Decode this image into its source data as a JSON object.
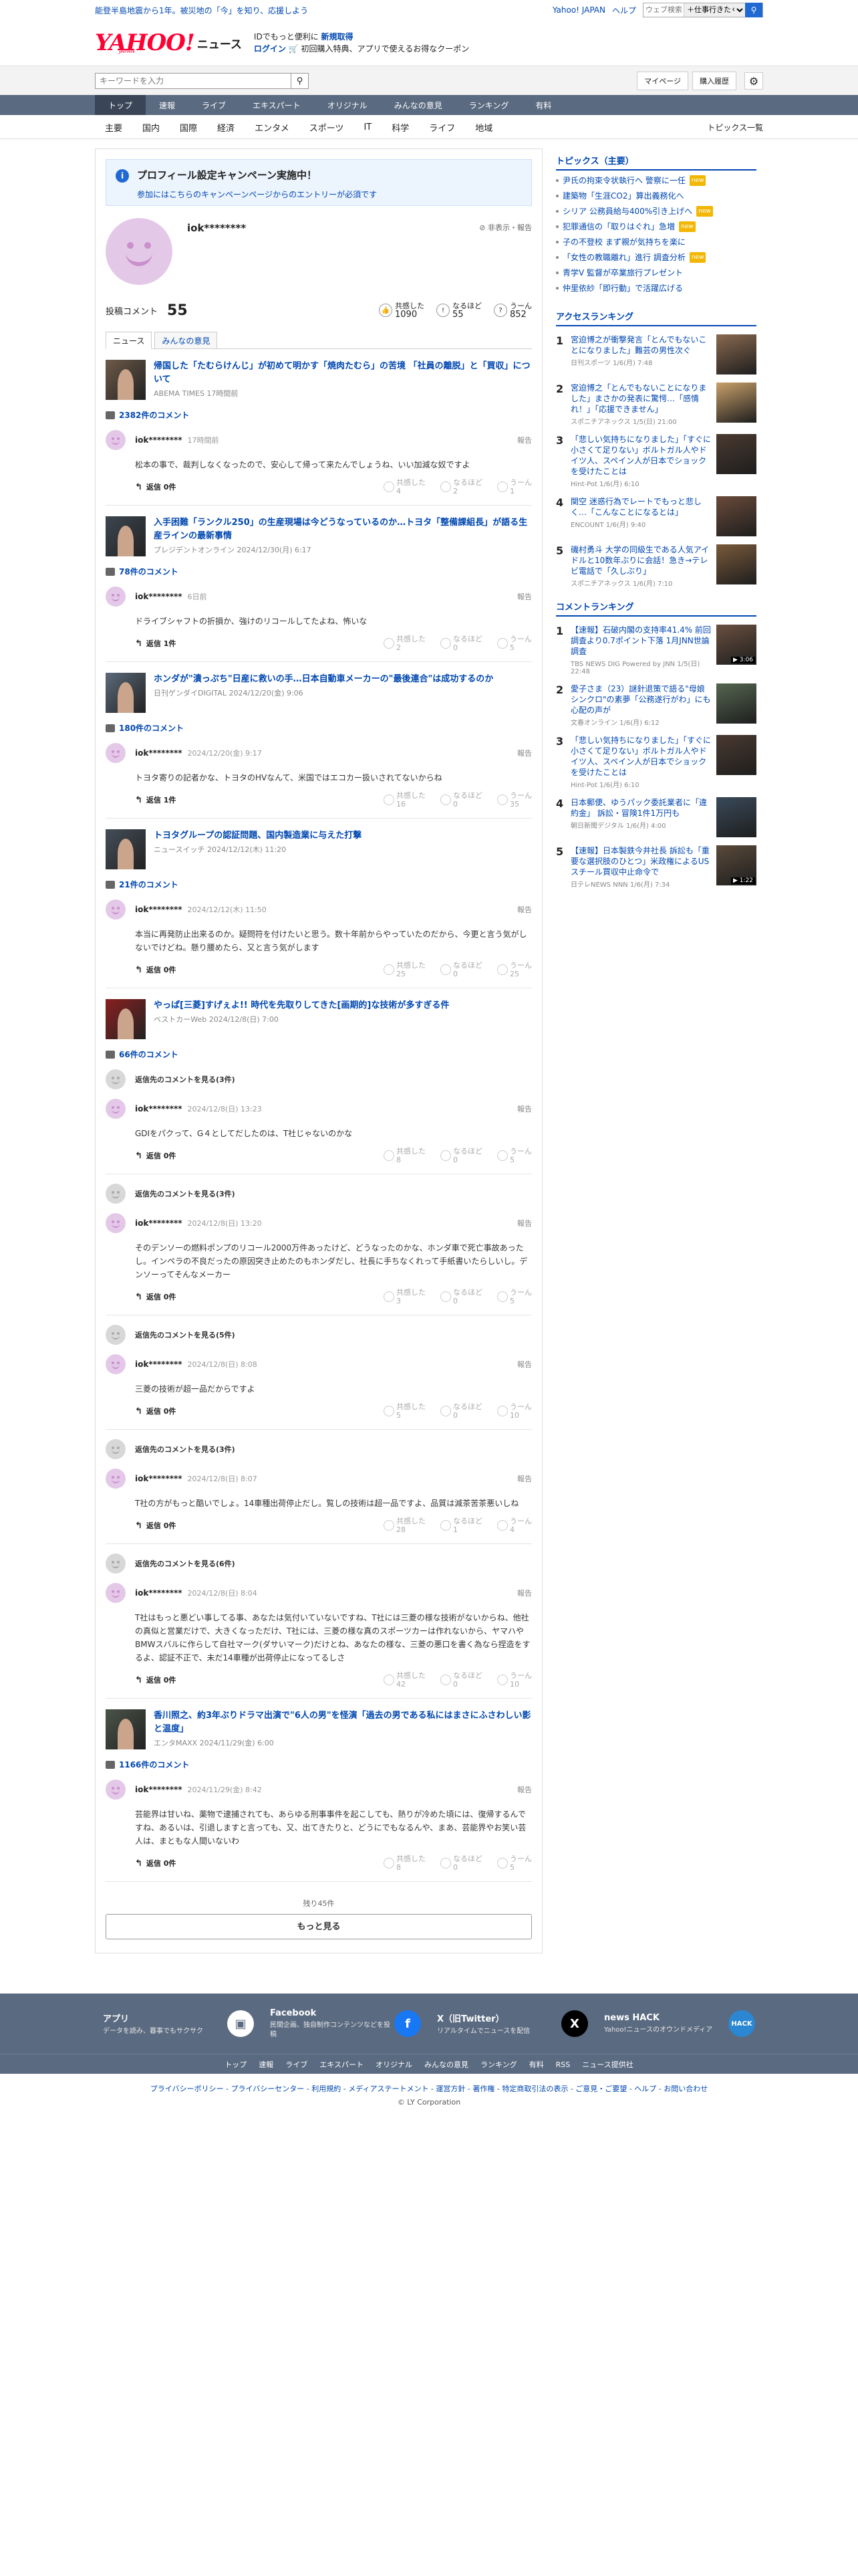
{
  "topbar": {
    "notice": "能登半島地震から1年。被災地の「今」を知り、応援しよう",
    "links": [
      "Yahoo! JAPAN",
      "ヘルプ"
    ],
    "search_placeholder": "ウェブ検索",
    "search_scope": "＋仕事行きたく..."
  },
  "header": {
    "logo": "YAHOO!",
    "logo_sub": "JAPAN",
    "logo_news": "ニュース",
    "promo_line1a": "IDでもっと便利に",
    "promo_line1b": "新規取得",
    "promo_login": "ログイン",
    "promo_line2": "初回購入特典、アプリで使えるお得なクーポン"
  },
  "search": {
    "placeholder": "キーワードを入力",
    "mypage": "マイページ",
    "history": "購入履歴"
  },
  "gnav": [
    "トップ",
    "速報",
    "ライブ",
    "エキスパート",
    "オリジナル",
    "みんなの意見",
    "ランキング",
    "有料"
  ],
  "subnav": [
    "主要",
    "国内",
    "国際",
    "経済",
    "エンタメ",
    "スポーツ",
    "IT",
    "科学",
    "ライフ",
    "地域"
  ],
  "subnav_right": "トピックス一覧",
  "campaign": {
    "title": "プロフィール設定キャンペーン実施中！",
    "sub": "参加にはこちらのキャンペーンページからのエントリーが必須です"
  },
  "profile": {
    "name": "iok********",
    "report": "非表示・報告",
    "comments_label": "投稿コメント",
    "comments_count": "55",
    "r1_label": "共感した",
    "r1": "1090",
    "r2_label": "なるほど",
    "r2": "55",
    "r3_label": "うーん",
    "r3": "852"
  },
  "tabs": [
    "ニュース",
    "みんなの意見"
  ],
  "reply_label": "返信 0件",
  "reply_label1": "返信 1件",
  "report_label": "報告",
  "react_labels": [
    "共感した",
    "なるほど",
    "うーん"
  ],
  "threads": [
    {
      "title": "帰国した「たむらけんじ」が初めて明かす「焼肉たむら」の苦境 「社員の離脱」と「買収」について",
      "source": "ABEMA TIMES 17時間前",
      "count": "2382件のコメント",
      "comments": [
        {
          "user": "iok********",
          "time": "17時間前",
          "body": "松本の事で、裁判しなくなったので、安心して帰って来たんでしょうね、いい加減な奴ですよ",
          "reply": "返信 0件",
          "r": [
            "4",
            "2",
            "1"
          ]
        }
      ]
    },
    {
      "title": "入手困難「ランクル250」の生産現場は今どうなっているのか…トヨタ「整備課組長」が語る生産ラインの最新事情",
      "source": "プレジデントオンライン 2024/12/30(月) 6:17",
      "count": "78件のコメント",
      "comments": [
        {
          "user": "iok********",
          "time": "6日前",
          "body": "ドライブシャフトの折損か、強けのリコールしてたよね、怖いな",
          "reply": "返信 1件",
          "r": [
            "2",
            "0",
            "5"
          ]
        }
      ]
    },
    {
      "title": "ホンダが\"潰っぷち\"日産に救いの手…日本自動車メーカーの\"最後連合\"は成功するのか",
      "source": "日刊ゲンダイDIGITAL 2024/12/20(金) 9:06",
      "count": "180件のコメント",
      "comments": [
        {
          "user": "iok********",
          "time": "2024/12/20(金) 9:17",
          "body": "トヨタ寄りの記者かな、トヨタのHVなんて、米国ではエコカー扱いされてないからね",
          "reply": "返信 1件",
          "r": [
            "16",
            "0",
            "35"
          ]
        }
      ]
    },
    {
      "title": "トヨタグループの認証問題、国内製造業に与えた打撃",
      "source": "ニュースイッチ 2024/12/12(木) 11:20",
      "count": "21件のコメント",
      "comments": [
        {
          "user": "iok********",
          "time": "2024/12/12(木) 11:50",
          "body": "本当に再発防止出来るのか。疑問符を付けたいと思う。数十年前からやっていたのだから、今更と言う気がしないでけどね。懸り腰めたら、又と言う気がします",
          "reply": "返信 0件",
          "r": [
            "25",
            "0",
            "25"
          ]
        }
      ]
    },
    {
      "title": "やっぱ[三菱]すげぇよ!! 時代を先取りしてきた[画期的]な技術が多すぎる件",
      "source": "ベストカーWeb 2024/12/8(日) 7:00",
      "count": "66件のコメント",
      "comments": [
        {
          "tree": "返信先のコメントを見る(3件)",
          "user": "iok********",
          "time": "2024/12/8(日) 13:23",
          "body": "GDIをパクって、G４としてだしたのは、T社じゃないのかな",
          "reply": "返信 0件",
          "r": [
            "8",
            "0",
            "5"
          ]
        },
        {
          "tree": "返信先のコメントを見る(3件)",
          "user": "iok********",
          "time": "2024/12/8(日) 13:20",
          "body": "そのデンソーの燃料ポンプのリコール2000万件あったけど、どうなったのかな、ホンダ車で死亡事故あったし。インペラの不良だったの原因突き止めたのもホンダだし、社長に手ちなくれって手紙書いたらしいし。デンソーってそんなメーカー",
          "reply": "返信 0件",
          "r": [
            "3",
            "0",
            "5"
          ]
        },
        {
          "tree": "返信先のコメントを見る(5件)",
          "user": "iok********",
          "time": "2024/12/8(日) 8:08",
          "body": "三菱の技術が超一品だからですよ",
          "reply": "返信 0件",
          "r": [
            "5",
            "0",
            "10"
          ]
        },
        {
          "tree": "返信先のコメントを見る(3件)",
          "user": "iok********",
          "time": "2024/12/8(日) 8:07",
          "body": "T社の方がもっと酷いでしょ。14車種出荷停止だし。覧しの技術は超一品ですよ、品質は減茶苦茶悪いしね",
          "reply": "返信 0件",
          "r": [
            "28",
            "1",
            "4"
          ]
        },
        {
          "tree": "返信先のコメントを見る(6件)",
          "user": "iok********",
          "time": "2024/12/8(日) 8:04",
          "body": "T社はもっと悪どい事してる事、あなたは気付いていないですね、T社には三菱の様な技術がないからね、他社の真似と営業だけで、大きくなっただけ、T社には、三菱の様な真のスポーツカーは作れないから、ヤマハやBMWスバルに作らして自社マーク(ダサいマーク)だけとね、あなたの様な、三菱の悪口を書く為なら捏造をするよ、認証不正で、未だ14車種が出荷停止になってるしさ",
          "reply": "返信 0件",
          "r": [
            "42",
            "0",
            "10"
          ]
        }
      ]
    },
    {
      "title": "香川照之、約3年ぶりドラマ出演で\"6人の男\"を怪演「過去の男である私にはまさにふさわしい影と温度」",
      "source": "エンタMAXX 2024/11/29(金) 6:00",
      "count": "1166件のコメント",
      "comments": [
        {
          "user": "iok********",
          "time": "2024/11/29(金) 8:42",
          "body": "芸能界は甘いね、薬物で逮捕されても、あらゆる刑事事件を起こしても、熱りが冷めた頃には、復帰するんですね、あるいは、引退しますと言っても、又、出てきたりと、どうにでもなるんや、まあ、芸能界やお笑い芸人は、まともな人間いないわ",
          "reply": "返信 0件",
          "r": [
            "8",
            "0",
            "5"
          ]
        }
      ]
    }
  ],
  "more": {
    "remaining": "残り45件",
    "button": "もっと見る"
  },
  "right": {
    "topics_title": "トピックス（主要）",
    "topics": [
      {
        "t": "尹氏の拘束令状執行へ 警察に一任",
        "tag": "new"
      },
      {
        "t": "建築物「生涯CO2」算出義務化へ",
        "tag": ""
      },
      {
        "t": "シリア 公務員給与400%引き上げへ",
        "tag": "new"
      },
      {
        "t": "犯罪通信の「取りはぐれ」急増",
        "tag": "new"
      },
      {
        "t": "子の不登校 まず親が気持ちを楽に",
        "tag": ""
      },
      {
        "t": "「女性の教職離れ」進行 調査分析",
        "tag": "new"
      },
      {
        "t": "青学V 監督が卒業旅行プレゼント",
        "tag": ""
      },
      {
        "t": "仲里依紗「即行動」で活躍広げる",
        "tag": ""
      }
    ],
    "access_title": "アクセスランキング",
    "access": [
      {
        "n": "1",
        "t": "宮迫博之が衝撃発言「とんでもないことになりました」難芸の男性次ぐ",
        "s": "日刊スポーツ 1/6(月) 7:48",
        "c": "#8a6a50",
        "v": ""
      },
      {
        "n": "2",
        "t": "宮迫博之「とんでもないことになりました」まさかの発表に驚愕…「感情れ！」「応援できません」",
        "s": "スポニチアネックス 1/5(日) 21:00",
        "c": "#c9a06a",
        "v": ""
      },
      {
        "n": "3",
        "t": "「悲しい気持ちになりました」「すぐに小さくて足りない」ボルトガル人やドイツ人、スペイン人が日本でショックを受けたことは",
        "s": "Hint-Pot 1/6(月) 6:10",
        "c": "#4a3a30",
        "v": ""
      },
      {
        "n": "4",
        "t": "関空 迷惑行為でレートでもっと悲しく…「こんなことになるとは」",
        "s": "ENCOUNT 1/6(月) 9:40",
        "c": "#6a4a3a",
        "v": ""
      },
      {
        "n": "5",
        "t": "磯村勇斗 大学の同級生である人気アイドルと10数年ぶりに会話！急き→テレビ電話で「久しぶり」",
        "s": "スポニチアネックス 1/6(月) 7:10",
        "c": "#7a5a3a",
        "v": ""
      }
    ],
    "comment_title": "コメントランキング",
    "comment": [
      {
        "n": "1",
        "t": "【速報】石破内閣の支持率41.4% 前回調査より0.7ポイント下落 1月JNN世論調査",
        "s": "TBS NEWS DIG Powered by JNN 1/5(日) 22:48",
        "c": "#6a5040",
        "v": "▶ 3:06"
      },
      {
        "n": "2",
        "t": "愛子さま（23）謎針退策で語る\"母娘シンクロ\"の素夢「公務遂行がわ」にも心配の声が",
        "s": "文春オンライン 1/6(月) 6:12",
        "c": "#556650",
        "v": ""
      },
      {
        "n": "3",
        "t": "「悲しい気持ちになりました」「すぐに小さくて足りない」ボルトガル人やドイツ人、スペイン人が日本でショックを受けたことは",
        "s": "Hint-Pot 1/6(月) 6:10",
        "c": "#4a3a30",
        "v": ""
      },
      {
        "n": "4",
        "t": "日本郵便、ゆうパック委託業者に「違約金」 訴訟・冒険1件1万円も",
        "s": "朝日新聞デジタル 1/6(月) 4:00",
        "c": "#3a4a5a",
        "v": ""
      },
      {
        "n": "5",
        "t": "【速報】日本製鉄今井社長 訴訟も「重要な選択肢のひとつ」米政権によるUSスチール買収中止命令で",
        "s": "日テレNEWS NNN 1/6(月) 7:34",
        "c": "#5a4a3a",
        "v": "▶ 1:22"
      }
    ]
  },
  "footer": {
    "items": [
      {
        "name": "アプリ",
        "desc": "データを読み、暮事でもサクサク",
        "icon": "▣",
        "bg": "#fff",
        "fg": "#5a6a80"
      },
      {
        "name": "Facebook",
        "desc": "民間企画、独自制作コンテンツなどを投稿",
        "icon": "f",
        "bg": "#1877f2",
        "fg": "#fff"
      },
      {
        "name": "X（旧Twitter）",
        "desc": "リアルタイムでニュースを配信",
        "icon": "X",
        "bg": "#000",
        "fg": "#fff"
      },
      {
        "name": "news HACK",
        "desc": "Yahoo!ニュースのオウンドメディア",
        "icon": "HACK",
        "bg": "#2b87d1",
        "fg": "#fff"
      }
    ],
    "nav": [
      "トップ",
      "速報",
      "ライブ",
      "エキスパート",
      "オリジナル",
      "みんなの意見",
      "ランキング",
      "有料",
      "RSS",
      "ニュース提供社"
    ],
    "links": "プライバシーポリシー - プライバシーセンター - 利用規約 - メディアステートメント - 運営方針 - 著作権 - 特定商取引法の表示 - ご意見・ご要望 - ヘルプ - お問い合わせ",
    "copy": "© LY Corporation"
  }
}
